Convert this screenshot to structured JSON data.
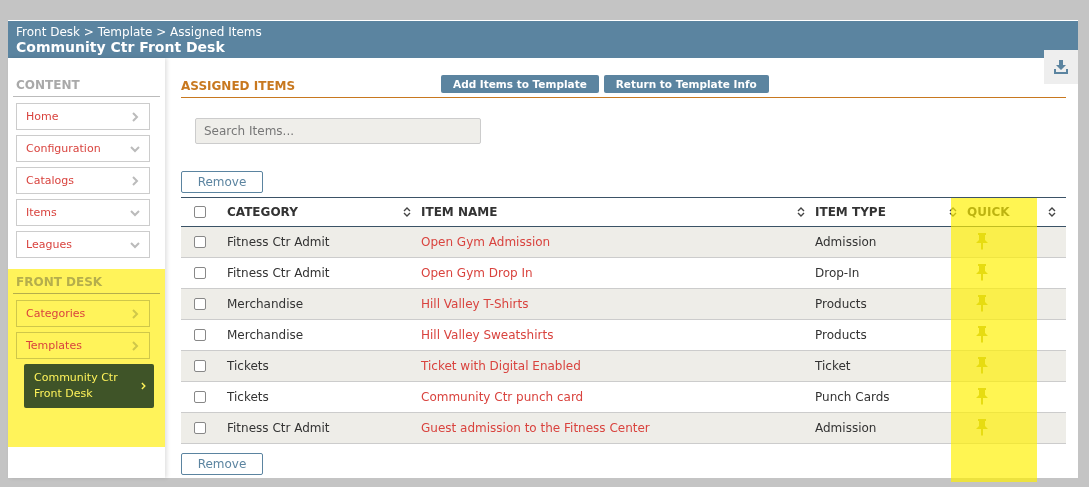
{
  "header": {
    "breadcrumb": "Front Desk > Template > Assigned Items",
    "title": "Community Ctr Front Desk"
  },
  "sidebar": {
    "sections": [
      {
        "title": "CONTENT",
        "highlighted": false,
        "items": [
          {
            "label": "Home",
            "kind": "link",
            "selected": false
          },
          {
            "label": "Configuration",
            "kind": "expand",
            "selected": false
          },
          {
            "label": "Catalogs",
            "kind": "link",
            "selected": false
          },
          {
            "label": "Items",
            "kind": "expand",
            "selected": false
          },
          {
            "label": "Leagues",
            "kind": "expand",
            "selected": false
          }
        ]
      },
      {
        "title": "FRONT DESK",
        "highlighted": true,
        "items": [
          {
            "label": "Categories",
            "kind": "link",
            "selected": false
          },
          {
            "label": "Templates",
            "kind": "link",
            "selected": false
          },
          {
            "label": "Community Ctr Front Desk",
            "kind": "link",
            "selected": true
          }
        ]
      }
    ]
  },
  "main": {
    "title": "ASSIGNED ITEMS",
    "buttons": [
      "Add Items to Template",
      "Return to Template Info"
    ],
    "search": {
      "placeholder": "Search Items..."
    },
    "remove_button": "Remove",
    "table": {
      "all_checked": false,
      "columns": [
        {
          "label": "CATEGORY",
          "highlighted": false
        },
        {
          "label": "ITEM NAME",
          "highlighted": false
        },
        {
          "label": "ITEM TYPE",
          "highlighted": false
        },
        {
          "label": "QUICK",
          "highlighted": true
        }
      ],
      "rows": [
        {
          "checked": false,
          "category": "Fitness Ctr Admit",
          "name": "Open Gym Admission",
          "type": "Admission"
        },
        {
          "checked": false,
          "category": "Fitness Ctr Admit",
          "name": "Open Gym Drop In",
          "type": "Drop-In"
        },
        {
          "checked": false,
          "category": "Merchandise",
          "name": "Hill Valley T-Shirts",
          "type": "Products"
        },
        {
          "checked": false,
          "category": "Merchandise",
          "name": "Hill Valley Sweatshirts",
          "type": "Products"
        },
        {
          "checked": false,
          "category": "Tickets",
          "name": "Ticket with Digital Enabled",
          "type": "Ticket"
        },
        {
          "checked": false,
          "category": "Tickets",
          "name": "Community Ctr punch card",
          "type": "Punch Cards"
        },
        {
          "checked": false,
          "category": "Fitness Ctr Admit",
          "name": "Guest admission to the Fitness Center",
          "type": "Admission"
        }
      ]
    },
    "bottom_button": "Remove"
  }
}
